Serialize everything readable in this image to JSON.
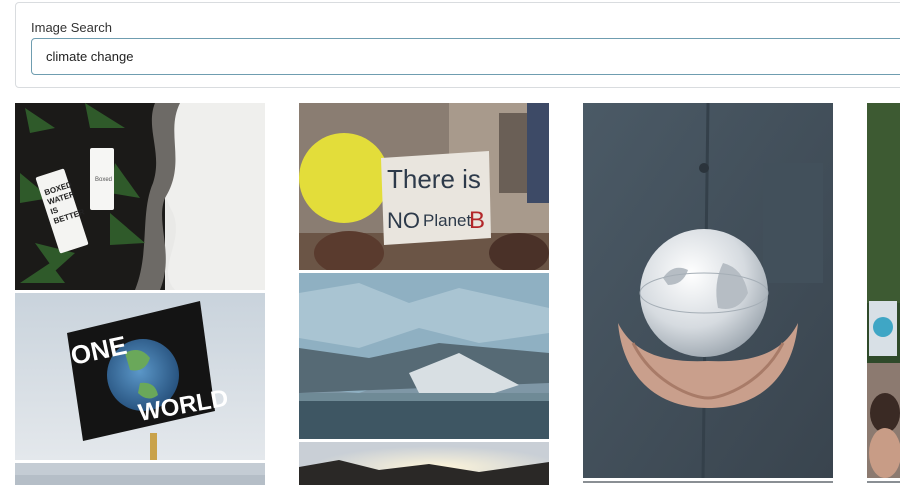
{
  "search": {
    "label": "Image Search",
    "value": "climate change"
  },
  "images": {
    "carton": {
      "text_lines": [
        "BOXED",
        "WATER",
        "IS",
        "BETTER"
      ],
      "small_text": "Boxed"
    },
    "sign_planet_b": {
      "line1": "There is",
      "line2_no": "NO",
      "line2_planet": "Planet",
      "line2_b": "B"
    },
    "sign_one_world": {
      "one": "ONE",
      "world": "WORLD"
    }
  }
}
